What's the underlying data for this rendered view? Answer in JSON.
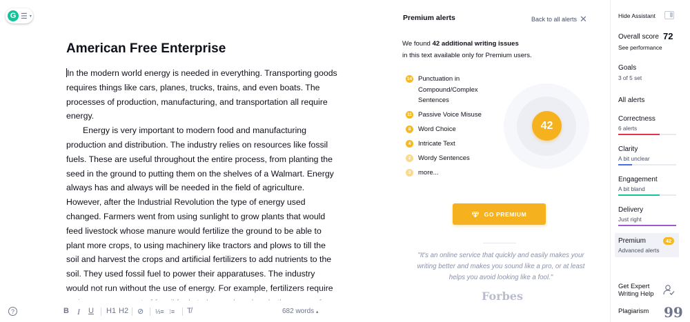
{
  "app": {
    "logo_letter": "G",
    "menu_glyph": "☰",
    "caret_glyph": "▾"
  },
  "document": {
    "title": "American Free Enterprise",
    "paragraphs": [
      "In the modern world energy is needed in everything. Transporting goods requires things like cars, planes, trucks, trains, and even boats. The processes of production, manufacturing, and transportation all require energy.",
      "Energy is very important to modern food and manufacturing production and distribution. The industry relies on resources like fossil fuels. These are useful throughout the entire process, from planting the seed in the ground to putting them on the shelves of a Walmart. Energy always has and always will be needed in the field of agriculture. However, after the Industrial Revolution the type of energy used changed. Farmers went from using sunlight to grow plants that would feed livestock whose manure would fertilize the ground to be able to plant more crops, to using machinery like tractors and plows to till the soil and harvest the crops and artificial fertilizers to add nutrients to the soil. They used fossil fuel to power their apparatuses. The industry would not run without the use of energy. For example, fertilizers require an immense amount of fossil fuels to be produced and other uses of energy to be applied. Ammonia, the building"
    ]
  },
  "toolbar": {
    "help_glyph": "?",
    "bold": "B",
    "italic": "I",
    "underline": "U",
    "h1": "H1",
    "h2": "H2",
    "link_glyph": "⊘",
    "ordered_list": "⅓≡",
    "bulleted_list": "⁝≡",
    "clear_format": "T̸",
    "word_count": "682 words",
    "word_count_caret": "▴"
  },
  "alerts_panel": {
    "title": "Premium alerts",
    "back_label": "Back to all alerts",
    "close_glyph": "✕",
    "found_prefix": "We found ",
    "found_bold": "42 additional writing issues",
    "found_suffix": "in this text available only for Premium users.",
    "issues": [
      {
        "count": "14",
        "label": "Punctuation in Compound/Complex Sentences",
        "faded": false
      },
      {
        "count": "11",
        "label": "Passive Voice Misuse",
        "faded": false
      },
      {
        "count": "8",
        "label": "Word Choice",
        "faded": false
      },
      {
        "count": "4",
        "label": "Intricate Text",
        "faded": false
      },
      {
        "count": "2",
        "label": "Wordy Sentences",
        "faded": true
      },
      {
        "count": "3",
        "label": "more...",
        "faded": true
      }
    ],
    "score": "42",
    "premium_button": "GO PREMIUM",
    "quote": "\"It's an online service that quickly and easily makes your writing better and makes you sound like a pro, or at least helps you avoid looking like a fool.\"",
    "quote_source": "Forbes"
  },
  "sidebar": {
    "hide_label": "Hide Assistant",
    "overall_label": "Overall score",
    "overall_value": "72",
    "see_performance": "See performance",
    "goals_label": "Goals",
    "goals_value": "3 of 5 set",
    "all_alerts": "All alerts",
    "categories": [
      {
        "name": "Correctness",
        "sub": "6 alerts",
        "color": "#e2344a",
        "fill": 0.72
      },
      {
        "name": "Clarity",
        "sub": "A bit unclear",
        "color": "#4a6ee0",
        "fill": 0.24
      },
      {
        "name": "Engagement",
        "sub": "A bit bland",
        "color": "#15c39a",
        "fill": 0.72
      },
      {
        "name": "Delivery",
        "sub": "Just right",
        "color": "#9b59d0",
        "fill": 1.0
      }
    ],
    "premium_name": "Premium",
    "premium_sub": "Advanced alerts",
    "premium_count": "42",
    "expert_label": "Get Expert Writing Help",
    "plagiarism_label": "Plagiarism",
    "plagiarism_glyph": "99"
  },
  "colors": {
    "brand_green": "#15c39a",
    "premium_gold": "#f6b11e",
    "text_dark": "#0e101a"
  }
}
